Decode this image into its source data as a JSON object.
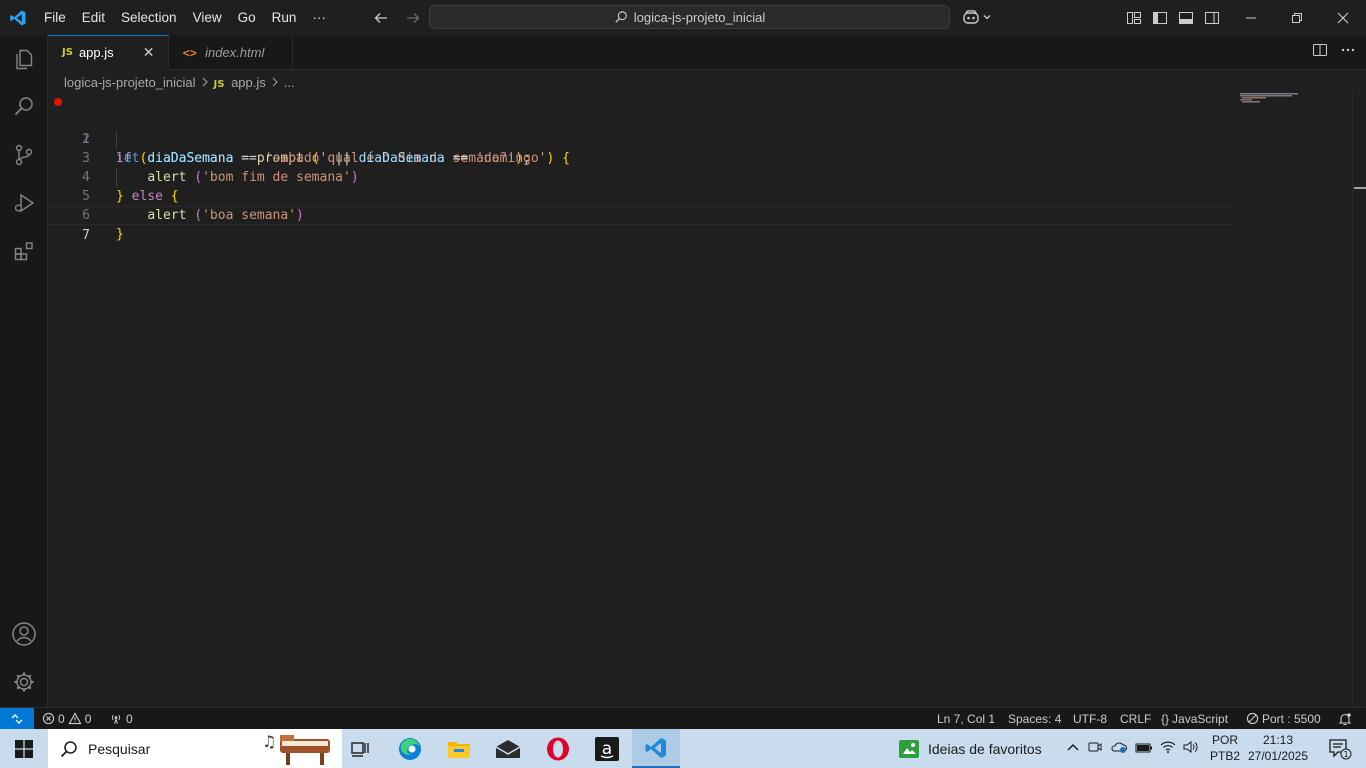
{
  "titlebar": {
    "menu": [
      "File",
      "Edit",
      "Selection",
      "View",
      "Go",
      "Run",
      "···"
    ],
    "search_text": "logica-js-projeto_inicial"
  },
  "tabs": [
    {
      "badge": "JS",
      "label": "app.js",
      "active": true
    },
    {
      "badge": "<>",
      "label": "index.html",
      "active": false
    }
  ],
  "breadcrumb": {
    "folder": "logica-js-projeto_inicial",
    "file_badge": "JS",
    "file": "app.js",
    "more": "..."
  },
  "editor": {
    "line_numbers": [
      "1",
      "2",
      "3",
      "4",
      "5",
      "6",
      "7"
    ],
    "current_line": 7,
    "breakpoint_line": 1
  },
  "code": {
    "l1": {
      "kw": "let",
      "var": "diaDaSemana",
      "op": " = ",
      "fn": "prompt",
      "open": "(",
      "str": "'qual é o dia da semana?'",
      "close": ")",
      "end": ";"
    },
    "l2": {
      "kw": "if",
      "open": "(",
      "var1": "diaDaSemana",
      "op1": " == ",
      "str1": "'sabado'",
      "op2": " || ",
      "var2": "diaDaSemana",
      "op3": " == ",
      "str2": "'domingo'",
      "close": ")",
      "brace": "{"
    },
    "l3": {
      "fn": "alert",
      "open": "(",
      "str": "'bom fim de semana'",
      "close": ")"
    },
    "l4": {
      "brace_close": "}",
      "kw": "else",
      "brace_open": "{"
    },
    "l5": {
      "fn": "alert",
      "open": "(",
      "str": "'boa semana'",
      "close": ")"
    },
    "l6": {
      "brace": "}"
    }
  },
  "statusbar": {
    "errors": "0",
    "warnings": "0",
    "ports": "0",
    "position": "Ln 7, Col 1",
    "spaces": "Spaces: 4",
    "encoding": "UTF-8",
    "eol": "CRLF",
    "language_icon": "{}",
    "language": "JavaScript",
    "port": "Port : 5500"
  },
  "taskbar": {
    "search_label": "Pesquisar",
    "widget_label": "Ideias de favoritos",
    "lang_top": "POR",
    "lang_bottom": "PTB2",
    "time": "21:13",
    "date": "27/01/2025",
    "notification_count": "1"
  },
  "colors": {
    "accent": "#0078d4",
    "breakpoint": "#e51400",
    "js_badge": "#cbcb41",
    "html_badge": "#e37933"
  }
}
